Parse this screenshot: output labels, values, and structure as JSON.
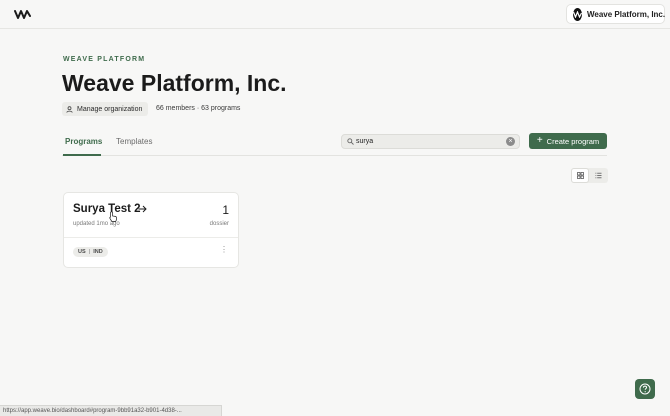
{
  "header": {
    "org_switcher_label": "Weave Platform, Inc."
  },
  "page": {
    "eyebrow": "WEAVE PLATFORM",
    "title": "Weave Platform, Inc.",
    "manage_label": "Manage organization",
    "stats": "66 members · 63 programs"
  },
  "tabs": [
    {
      "label": "Programs",
      "active": true
    },
    {
      "label": "Templates",
      "active": false
    }
  ],
  "search": {
    "value": "surya",
    "placeholder": ""
  },
  "create_button": {
    "label": "Create program"
  },
  "programs": [
    {
      "name": "Surya Test 2",
      "updated": "updated 1mo ago",
      "count": "1",
      "count_label": "dossier",
      "tags": [
        "US",
        "IND"
      ]
    }
  ],
  "status_bar": {
    "url": "https://app.weave.bio/dashboard#program-9bb91a32-b901-4d38-..."
  },
  "colors": {
    "accent": "#3f6b4c",
    "background": "#f7f7f6"
  },
  "icons": {
    "logo": "weave-logo-icon",
    "search": "search-icon",
    "clear": "clear-icon",
    "grid": "grid-view-icon",
    "list": "list-view-icon",
    "help": "help-icon"
  }
}
